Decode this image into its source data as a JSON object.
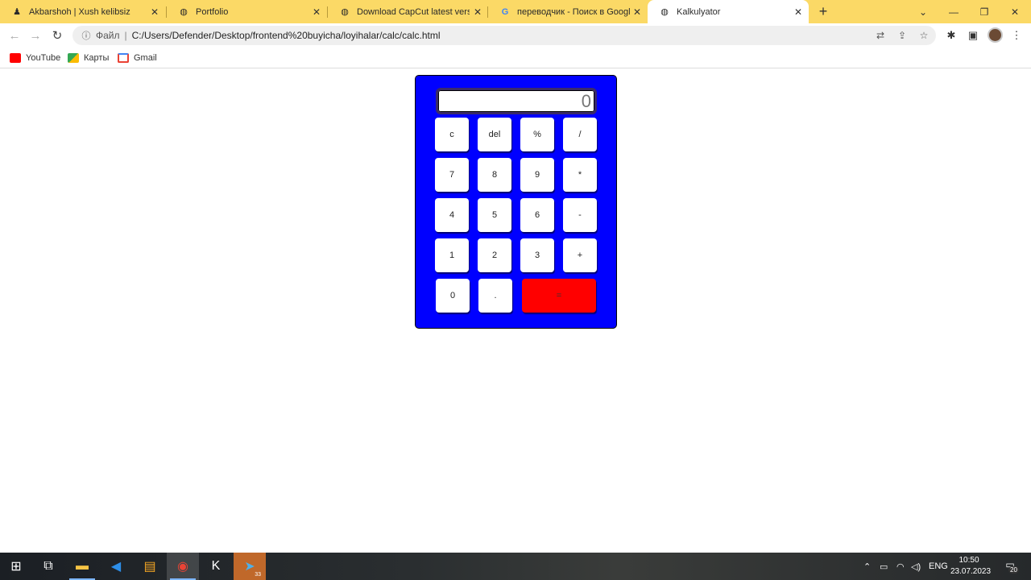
{
  "browser": {
    "tabs": [
      {
        "title": "Akbarshoh | Xush kelibsiz",
        "icon": "person-icon",
        "active": false
      },
      {
        "title": "Portfolio",
        "icon": "globe-icon",
        "active": false
      },
      {
        "title": "Download CapCut latest version",
        "icon": "globe-icon",
        "active": false
      },
      {
        "title": "переводчик - Поиск в Google",
        "icon": "google-icon",
        "active": false
      },
      {
        "title": "Kalkulyator",
        "icon": "globe-icon",
        "active": true
      }
    ],
    "file_label": "Файл",
    "url": "C:/Users/Defender/Desktop/frontend%20buyicha/loyihalar/calc/calc.html",
    "bookmarks": [
      {
        "label": "YouTube",
        "color": "#ff0000"
      },
      {
        "label": "Карты",
        "color": "#34a853"
      },
      {
        "label": "Gmail",
        "color": "#ea4335"
      }
    ]
  },
  "calculator": {
    "display": "0",
    "rows": [
      [
        "c",
        "del",
        "%",
        "/"
      ],
      [
        "7",
        "8",
        "9",
        "*"
      ],
      [
        "4",
        "5",
        "6",
        "-"
      ],
      [
        "1",
        "2",
        "3",
        "+"
      ],
      [
        "0",
        ".",
        "="
      ]
    ],
    "colors": {
      "body": "#0000ff",
      "equals": "#ff0000",
      "keys": "#ffffff"
    }
  },
  "taskbar": {
    "language": "ENG",
    "time": "10:50",
    "date": "23.07.2023",
    "notification_count": "20",
    "telegram_badge": "33"
  }
}
